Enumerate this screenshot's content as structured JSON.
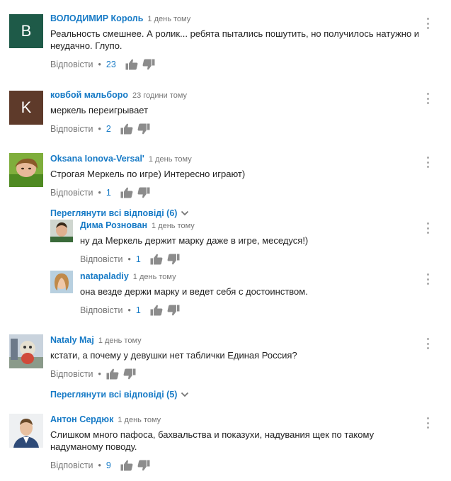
{
  "labels": {
    "reply": "Відповісти",
    "dot": "•"
  },
  "colors": {
    "link_blue": "#167ac6",
    "meta_gray": "#767676",
    "avatar_b": "#1e5a48",
    "avatar_k": "#5e3a2a"
  },
  "comments": [
    {
      "author": "ВОЛОДИМИР Король",
      "time": "1 день тому",
      "text": "Реальность смешнее. А ролик... ребята пытались пошутить, но получилось натужно и неудачно. Глупо.",
      "likes": "23",
      "avatar_letter": "B"
    },
    {
      "author": "ковбой мальборо",
      "time": "23 години тому",
      "text": "меркель переигрывает",
      "likes": "2",
      "avatar_letter": "K"
    },
    {
      "author": "Oksana Ionova-Versal'",
      "time": "1 день тому",
      "text": "Строгая Меркель по игре) Интересно играют)",
      "likes": "1",
      "view_replies": "Переглянути всі відповіді (6)",
      "replies": [
        {
          "author": "Дима Рознован",
          "time": "1 день тому",
          "text": "ну да Меркель держит марку даже в игре, меседуся!)",
          "likes": "1"
        },
        {
          "author": "natapaladiy",
          "time": "1 день тому",
          "text": "она везде держи марку и ведет себя с достоинством.",
          "likes": "1"
        }
      ]
    },
    {
      "author": "Nataly Maj",
      "time": "1 день тому",
      "text": "кстати, а почему у девушки нет таблички Единая Россия?",
      "view_replies": "Переглянути всі відповіді (5)"
    },
    {
      "author": "Антон Сердюк",
      "time": "1 день тому",
      "text": "Слишком много пафоса, бахвальства и показухи, надувания щек по такому надуманому поводу.",
      "likes": "9"
    }
  ]
}
